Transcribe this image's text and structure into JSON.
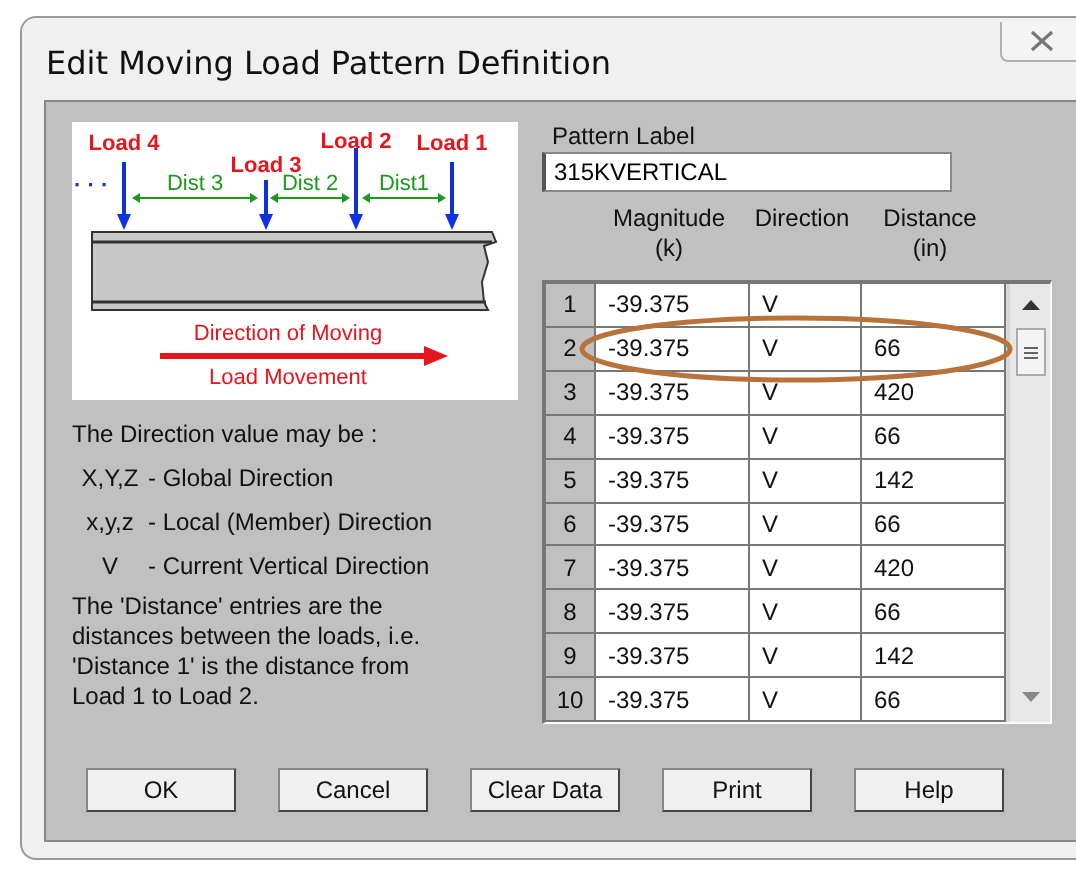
{
  "window": {
    "title": "Edit Moving Load Pattern Definition"
  },
  "diagram": {
    "loads": [
      "Load 4",
      "Load 3",
      "Load 2",
      "Load 1"
    ],
    "dists": [
      "Dist 3",
      "Dist 2",
      "Dist1"
    ],
    "ellipsis": "· · ·",
    "caption": [
      "Direction of Moving",
      "Load Movement"
    ]
  },
  "help": {
    "intro": "The Direction value may be :",
    "options": [
      {
        "code": "X,Y,Z",
        "text": "-  Global Direction"
      },
      {
        "code": "x,y,z",
        "text": "-  Local (Member) Direction"
      },
      {
        "code": "V",
        "text": "-  Current Vertical Direction"
      }
    ],
    "note": "The 'Distance' entries are the distances between the loads, i.e. 'Distance 1' is the distance from Load 1 to Load 2."
  },
  "pattern_label": {
    "label": "Pattern Label",
    "value": "315KVERTICAL"
  },
  "table": {
    "columns": [
      [
        "Magnitude",
        "(k)"
      ],
      [
        "Direction"
      ],
      [
        "Distance",
        "(in)"
      ]
    ],
    "rows": [
      {
        "index": "1",
        "magnitude": "-39.375",
        "direction": "V",
        "distance": ""
      },
      {
        "index": "2",
        "magnitude": "-39.375",
        "direction": "V",
        "distance": "66"
      },
      {
        "index": "3",
        "magnitude": "-39.375",
        "direction": "V",
        "distance": "420"
      },
      {
        "index": "4",
        "magnitude": "-39.375",
        "direction": "V",
        "distance": "66"
      },
      {
        "index": "5",
        "magnitude": "-39.375",
        "direction": "V",
        "distance": "142"
      },
      {
        "index": "6",
        "magnitude": "-39.375",
        "direction": "V",
        "distance": "66"
      },
      {
        "index": "7",
        "magnitude": "-39.375",
        "direction": "V",
        "distance": "420"
      },
      {
        "index": "8",
        "magnitude": "-39.375",
        "direction": "V",
        "distance": "66"
      },
      {
        "index": "9",
        "magnitude": "-39.375",
        "direction": "V",
        "distance": "142"
      },
      {
        "index": "10",
        "magnitude": "-39.375",
        "direction": "V",
        "distance": "66"
      }
    ]
  },
  "buttons": [
    "OK",
    "Cancel",
    "Clear Data",
    "Print",
    "Help"
  ]
}
